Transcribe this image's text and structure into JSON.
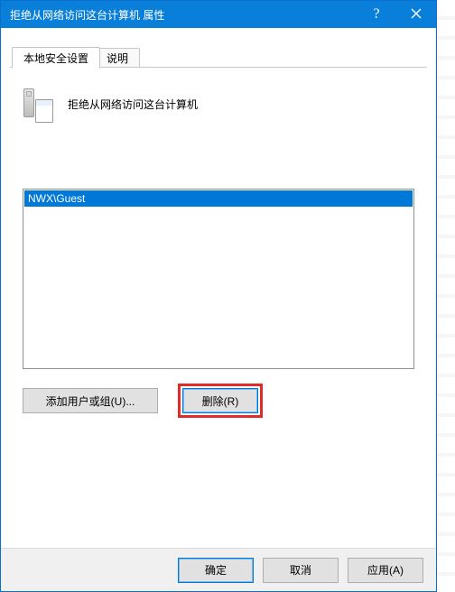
{
  "window": {
    "title": "拒绝从网络访问这台计算机 属性",
    "help": "?",
    "close": "×"
  },
  "tabs": {
    "t1": "本地安全设置",
    "t2": "说明"
  },
  "policy": {
    "icon_name": "security-policy-icon",
    "title": "拒绝从网络访问这台计算机"
  },
  "userlist": {
    "rows": [
      {
        "label": "NWX\\Guest"
      }
    ]
  },
  "buttons": {
    "add": "添加用户或组(U)...",
    "remove": "删除(R)"
  },
  "footer": {
    "ok": "确定",
    "cancel": "取消",
    "apply": "应用(A)"
  }
}
